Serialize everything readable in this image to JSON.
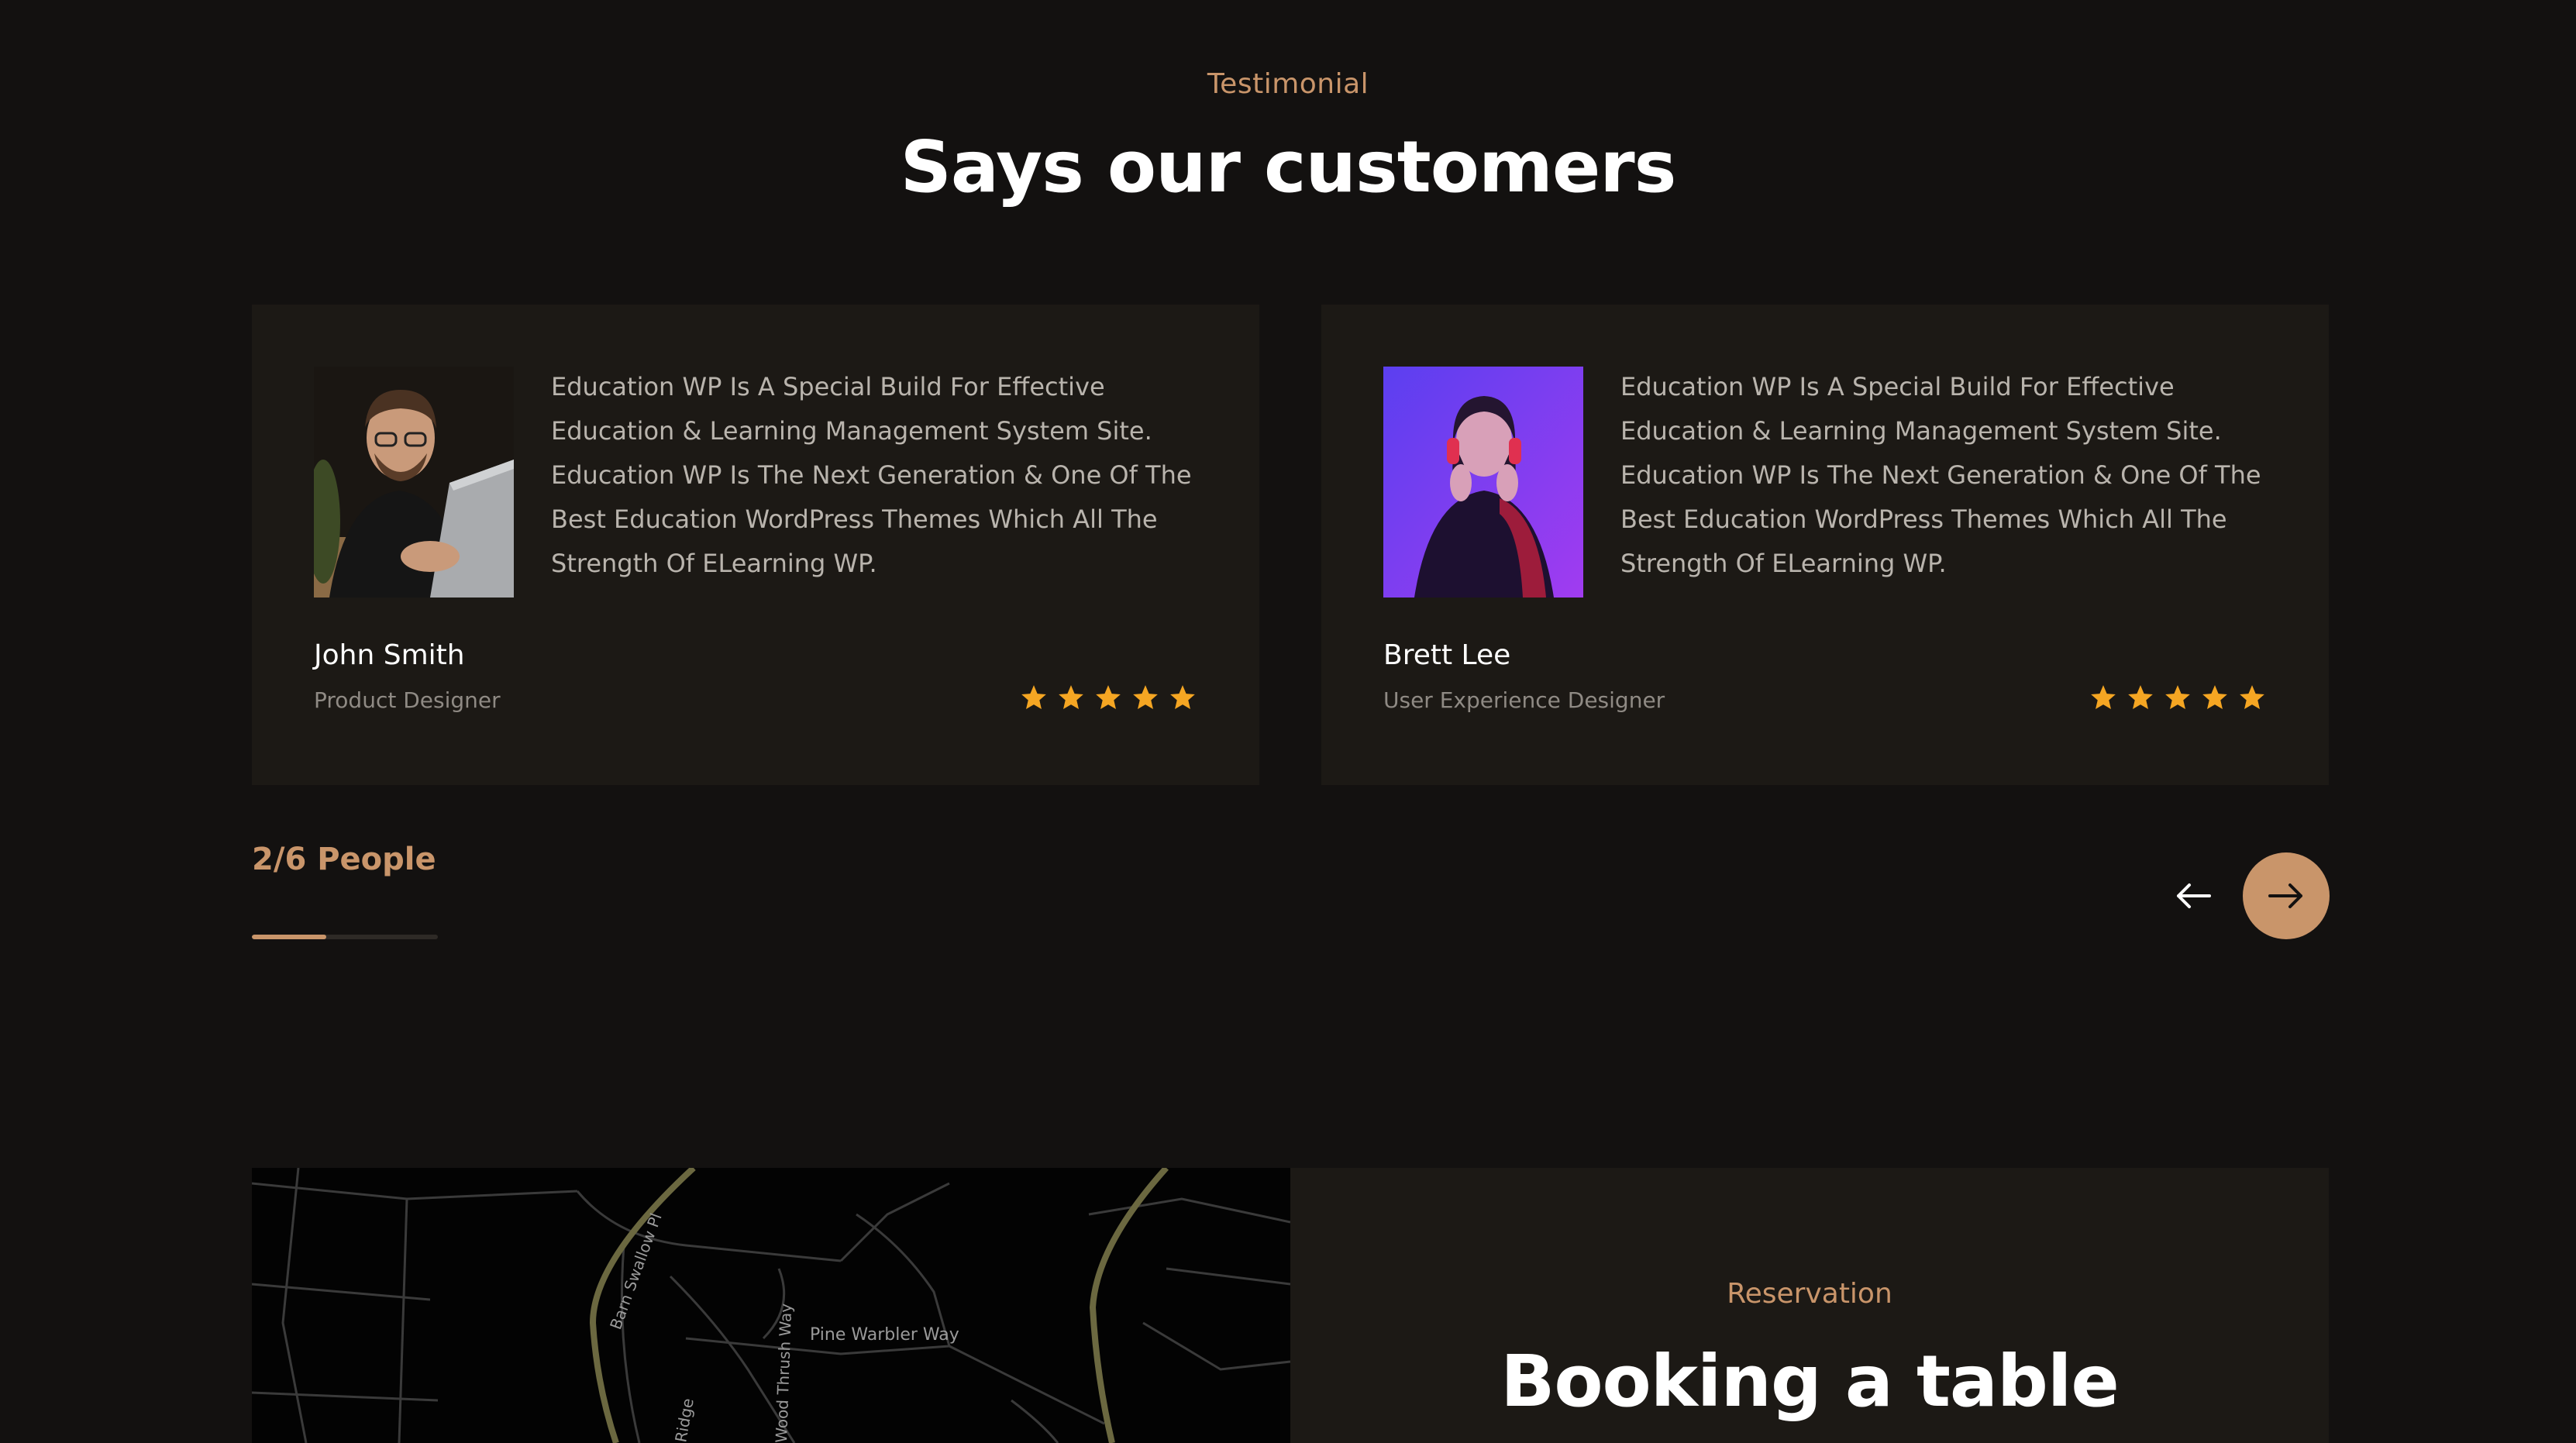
{
  "testimonial_section": {
    "eyebrow": "Testimonial",
    "title": "Says our customers",
    "cards": [
      {
        "quote": "Education WP Is A Special Build For Effective Education & Learning Management System Site. Education WP Is The Next Generation & One Of The Best Education WordPress Themes Which All The Strength Of ELearning WP.",
        "name": "John Smith",
        "role": "Product Designer",
        "rating": 5
      },
      {
        "quote": "Education WP Is A Special Build For Effective Education & Learning Management System Site. Education WP Is The Next Generation & One Of The Best Education WordPress Themes Which All The Strength Of ELearning WP.",
        "name": "Brett Lee",
        "role": "User Experience Designer",
        "rating": 5
      }
    ],
    "counter": "2/6 People",
    "progress": 0.4,
    "prev_icon": "arrow-left-icon",
    "next_icon": "arrow-right-icon"
  },
  "map": {
    "streets": [
      "Barn Swallow Pl",
      "Pine Warbler Way",
      "Wood Thrush Way",
      "Ridge"
    ]
  },
  "reservation_section": {
    "eyebrow": "Reservation",
    "title": "Booking a table"
  },
  "colors": {
    "background": "#131110",
    "card": "#1c1915",
    "accent": "#c9956a",
    "star": "#f5a623"
  }
}
